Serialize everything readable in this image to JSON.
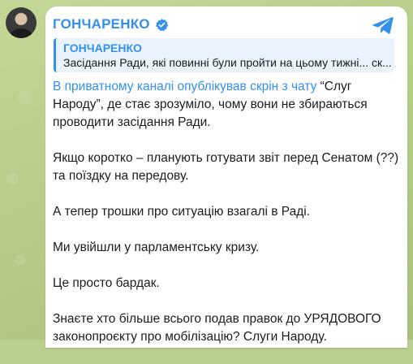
{
  "post": {
    "channel_name": "ГОНЧАРЕНКО",
    "quote": {
      "author": "ГОНЧАРЕНКО",
      "text": "Засідання Ради, які повинні були пройти на цьому тижні... ск..."
    },
    "paragraphs": [
      {
        "link": "В приватному каналі опублікував скрін з чату",
        "text": " “Слуг Народу”, де стає зрозуміло, чому вони не збираються проводити засідання Ради."
      },
      {
        "link": "",
        "text": "Якщо коротко – планують готувати звіт перед Сенатом (??) та поїздку на передову."
      },
      {
        "link": "",
        "text": "А тепер трошки про ситуацію взагалі в Раді."
      },
      {
        "link": "",
        "text": "Ми увійшли у парламентську кризу."
      },
      {
        "link": "",
        "text": "Це просто бардак."
      },
      {
        "link": "",
        "text": "Знаєте хто більше всього подав правок до УРЯДОВОГО законопроєкту про мобілізацію? Слуги Народу."
      }
    ]
  },
  "icons": {
    "verified": "verified-badge-icon",
    "share": "telegram-plane-icon",
    "avatar": "channel-avatar"
  },
  "colors": {
    "accent": "#3390ec",
    "background": "#b9cf8f",
    "bubble": "#ffffff"
  }
}
